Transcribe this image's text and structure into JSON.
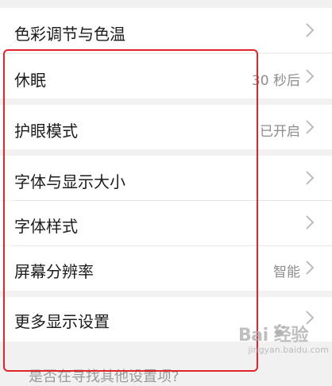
{
  "settings": {
    "items": [
      {
        "label": "色彩调节与色温",
        "value": ""
      },
      {
        "label": "休眠",
        "value": "30 秒后"
      },
      {
        "label": "护眼模式",
        "value": "已开启"
      },
      {
        "label": "字体与显示大小",
        "value": ""
      },
      {
        "label": "字体样式",
        "value": ""
      },
      {
        "label": "屏幕分辨率",
        "value": "智能"
      },
      {
        "label": "更多显示设置",
        "value": ""
      }
    ],
    "bottom_hint": "是否在寻找其他设置项?"
  },
  "watermark": {
    "main": "Bai 经验",
    "sub": "jingyan.baidu.com"
  },
  "colors": {
    "highlight_border": "#e3232c",
    "background": "#f1f1f1",
    "row_background": "#ffffff"
  },
  "icons": {
    "row_chevron": "chevron-right-icon",
    "watermark_logo": "paw-icon"
  }
}
